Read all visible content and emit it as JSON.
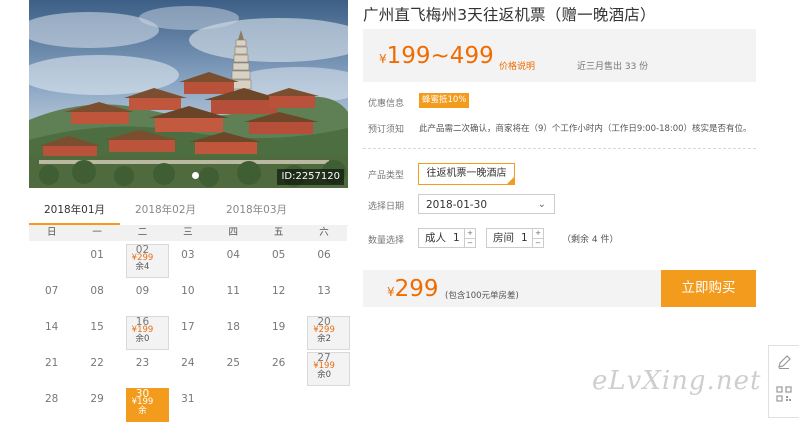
{
  "hero": {
    "photo_id": "ID:2257120"
  },
  "calendar": {
    "months": [
      "2018年01月",
      "2018年02月",
      "2018年03月"
    ],
    "active_month_index": 0,
    "weekdays": [
      "日",
      "一",
      "二",
      "三",
      "四",
      "五",
      "六"
    ],
    "days": [
      {
        "label": ""
      },
      {
        "label": "01"
      },
      {
        "label": "02",
        "price": "¥299",
        "stock": "余4"
      },
      {
        "label": "03"
      },
      {
        "label": "04"
      },
      {
        "label": "05"
      },
      {
        "label": "06"
      },
      {
        "label": "07"
      },
      {
        "label": "08"
      },
      {
        "label": "09"
      },
      {
        "label": "10"
      },
      {
        "label": "11"
      },
      {
        "label": "12"
      },
      {
        "label": "13"
      },
      {
        "label": "14"
      },
      {
        "label": "15"
      },
      {
        "label": "16",
        "price": "¥199",
        "stock": "余0"
      },
      {
        "label": "17"
      },
      {
        "label": "18"
      },
      {
        "label": "19"
      },
      {
        "label": "20",
        "price": "¥299",
        "stock": "余2"
      },
      {
        "label": "21"
      },
      {
        "label": "22"
      },
      {
        "label": "23"
      },
      {
        "label": "24"
      },
      {
        "label": "25"
      },
      {
        "label": "26"
      },
      {
        "label": "27",
        "price": "¥199",
        "stock": "余0"
      },
      {
        "label": "28"
      },
      {
        "label": "29"
      },
      {
        "label": "30",
        "price": "¥199",
        "stock": "余",
        "selected": true
      },
      {
        "label": "31"
      }
    ]
  },
  "product": {
    "title": "广州直飞梅州3天往返机票（赠一晚酒店）",
    "price_currency": "¥",
    "price_range": "199~499",
    "price_note": "价格说明",
    "sold_text": "近三月售出 33 份",
    "promo_label": "优惠信息",
    "promo_badge": "蜂蜜抵10%",
    "booking_label": "预订须知",
    "booking_note": "此产品需二次确认，商家将在（9）个工作小时内（工作日9:00-18:00）核实是否有位。",
    "type_label": "产品类型",
    "type_option": "往返机票一晚酒店",
    "date_label": "选择日期",
    "date_value": "2018-01-30",
    "qty_label": "数量选择",
    "adult_label": "成人",
    "adult_qty": "1",
    "room_label": "房间",
    "room_qty": "1",
    "remaining": "（剩余 4 件）",
    "total_currency": "¥",
    "total_price": "299",
    "total_note": "(包含100元单房差)",
    "buy_label": "立即购买"
  },
  "watermark": "eLvXing.net",
  "colors": {
    "accent": "#f29b1c",
    "price": "#ef6c00",
    "panel": "#f3f3f3"
  }
}
